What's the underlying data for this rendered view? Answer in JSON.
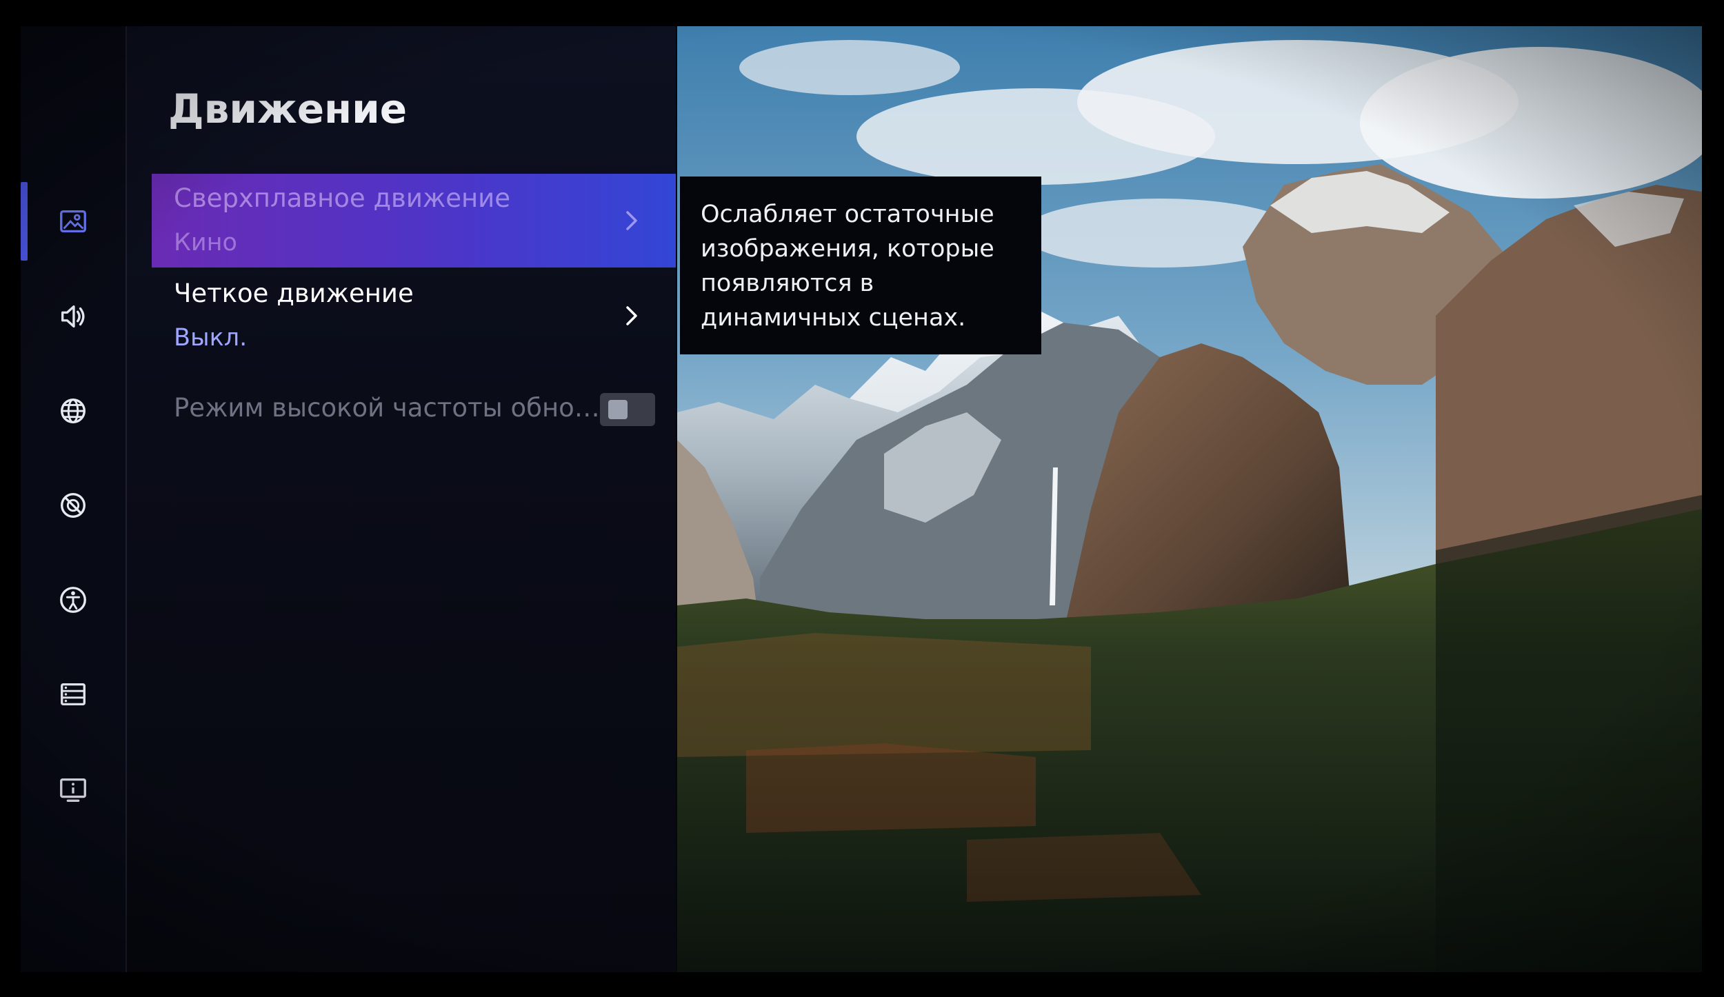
{
  "panel": {
    "title": "Движение",
    "items": [
      {
        "label": "Сверхплавное движение",
        "value": "Кино"
      },
      {
        "label": "Четкое движение",
        "value": "Выкл."
      },
      {
        "label": "Режим высокой частоты обно…",
        "toggle": "off"
      }
    ]
  },
  "tooltip": {
    "text": "Ослабляет остаточные изображения, которые появляются в динамичных сценах."
  },
  "rail": {
    "icons": [
      "picture-icon",
      "sound-icon",
      "globe-icon",
      "privacy-icon",
      "accessibility-icon",
      "list-icon",
      "info-icon"
    ],
    "active": "picture-icon"
  },
  "colors": {
    "accent": "#4f5bf0",
    "selected_gradient_start": "#6a2bb4",
    "selected_gradient_end": "#3346d6",
    "value_text": "#9ea6ff"
  }
}
